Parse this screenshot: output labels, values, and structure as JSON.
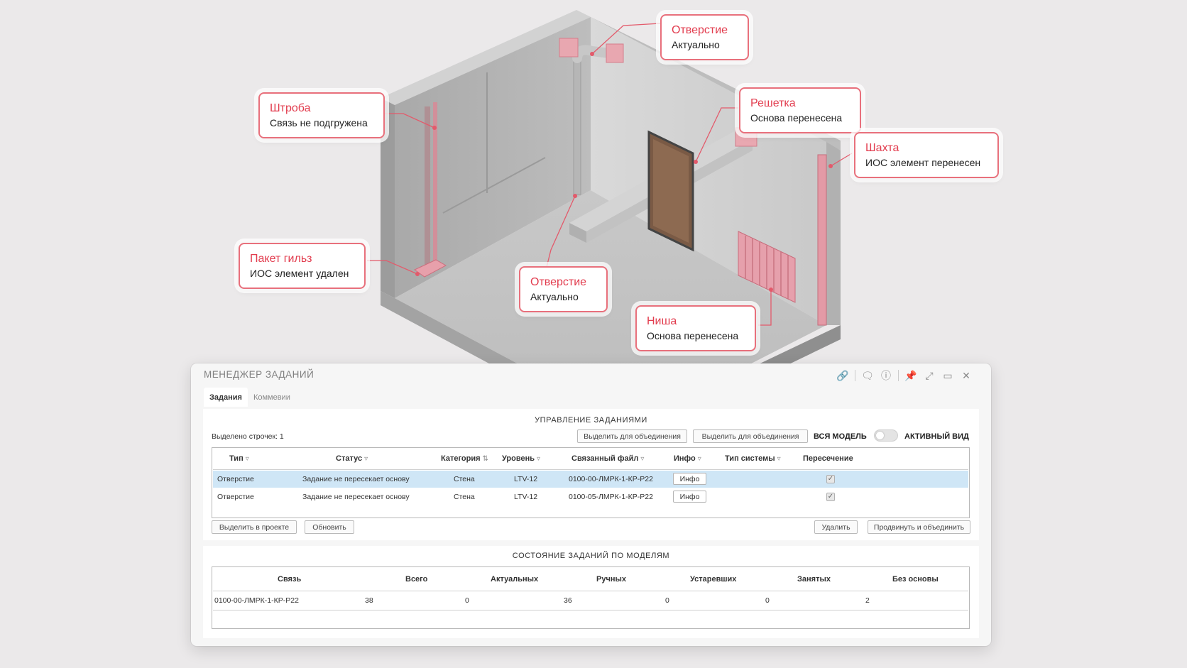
{
  "callouts": [
    {
      "title": "Отверстие",
      "status": "Актуально"
    },
    {
      "title": "Штроба",
      "status": "Связь не подгружена"
    },
    {
      "title": "Решетка",
      "status": "Основа перенесена"
    },
    {
      "title": "Шахта",
      "status": "ИОС элемент перенесен"
    },
    {
      "title": "Пакет гильз",
      "status": "ИОС элемент удален"
    },
    {
      "title": "Отверстие",
      "status": "Актуально"
    },
    {
      "title": "Ниша",
      "status": "Основа перенесена"
    }
  ],
  "colors": {
    "accent": "#e23c4e",
    "selected_row": "#cfe6f6"
  },
  "window": {
    "title": "МЕНЕДЖЕР ЗАДАНИЙ",
    "icons": [
      "link-icon",
      "chat-icon",
      "help-icon",
      "pin-icon",
      "minimize-icon",
      "maximize-icon",
      "close-icon"
    ],
    "tabs": [
      {
        "label": "Задания",
        "active": true
      },
      {
        "label": "Коммевии",
        "active": false
      }
    ]
  },
  "tasks": {
    "title": "УПРАВЛЕНИЕ ЗАДАНИЯМИ",
    "selected_count": "Выделено строчек: 1",
    "btn_select_merge_1": "Выделить для объединения",
    "btn_select_merge_2": "Выделить для объединения",
    "mode_all": "ВСЯ МОДЕЛЬ",
    "mode_active": "АКТИВНЫЙ ВИД",
    "columns": [
      "Тип",
      "Статус",
      "Категория",
      "Уровень",
      "Связанный файл",
      "Инфо",
      "Тип системы",
      "Пересечение"
    ],
    "rows": [
      {
        "type": "Отверстие",
        "status": "Задание не пересекает основу",
        "category": "Стена",
        "level": "LTV-12",
        "file": "0100-00-ЛМРК-1-КР-Р22",
        "info": "Инфо",
        "system": "",
        "intersect": true,
        "selected": true
      },
      {
        "type": "Отверстие",
        "status": "Задание не пересекает основу",
        "category": "Стена",
        "level": "LTV-12",
        "file": "0100-05-ЛМРК-1-КР-Р22",
        "info": "Инфо",
        "system": "",
        "intersect": true,
        "selected": false
      }
    ],
    "btn_select_project": "Выделить в проекте",
    "btn_refresh": "Обновить",
    "btn_delete": "Удалить",
    "btn_promote_merge": "Продвинуть и объединить"
  },
  "models": {
    "title": "СОСТОЯНИЕ ЗАДАНИЙ ПО МОДЕЛЯМ",
    "columns": [
      "Связь",
      "Всего",
      "Актуальных",
      "Ручных",
      "Устаревших",
      "Занятых",
      "Без основы"
    ],
    "rows": [
      {
        "link": "0100-00-ЛМРК-1-КР-Р22",
        "total": "38",
        "actual": "0",
        "manual": "36",
        "outdated": "0",
        "busy": "0",
        "no_base": "2"
      }
    ]
  }
}
